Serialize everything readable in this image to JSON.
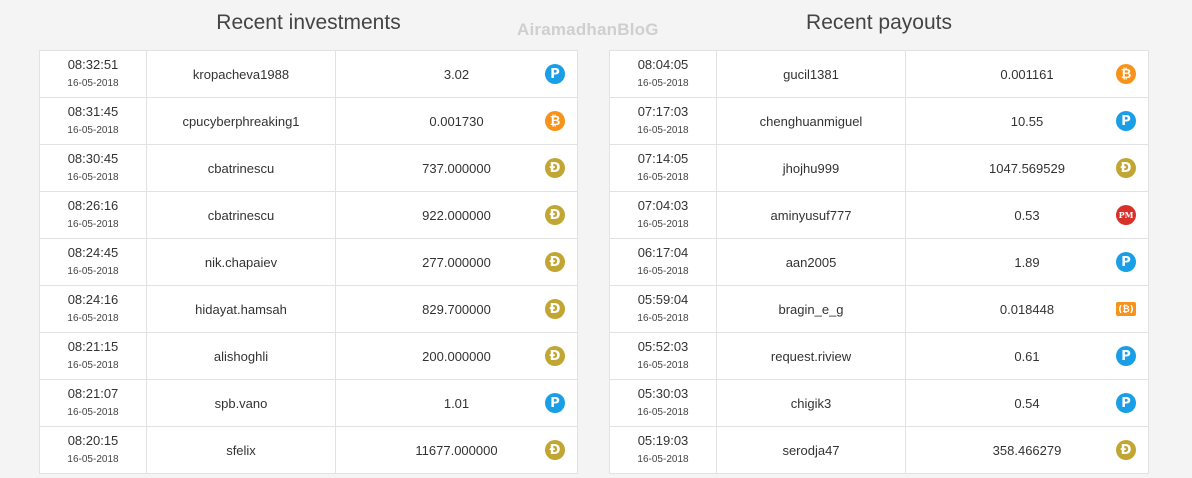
{
  "watermark": "AiramadhanBloG",
  "investments": {
    "title": "Recent investments",
    "rows": [
      {
        "time": "08:32:51",
        "date": "16-05-2018",
        "user": "kropacheva1988",
        "amount": "3.02",
        "coin": "payeer-icon",
        "glyph": "P"
      },
      {
        "time": "08:31:45",
        "date": "16-05-2018",
        "user": "cpucyberphreaking1",
        "amount": "0.001730",
        "coin": "bitcoin-icon",
        "glyph": "₿"
      },
      {
        "time": "08:30:45",
        "date": "16-05-2018",
        "user": "cbatrinescu",
        "amount": "737.000000",
        "coin": "dogecoin-icon",
        "glyph": "Đ"
      },
      {
        "time": "08:26:16",
        "date": "16-05-2018",
        "user": "cbatrinescu",
        "amount": "922.000000",
        "coin": "dogecoin-icon",
        "glyph": "Đ"
      },
      {
        "time": "08:24:45",
        "date": "16-05-2018",
        "user": "nik.chapaiev",
        "amount": "277.000000",
        "coin": "dogecoin-icon",
        "glyph": "Đ"
      },
      {
        "time": "08:24:16",
        "date": "16-05-2018",
        "user": "hidayat.hamsah",
        "amount": "829.700000",
        "coin": "dogecoin-icon",
        "glyph": "Đ"
      },
      {
        "time": "08:21:15",
        "date": "16-05-2018",
        "user": "alishoghli",
        "amount": "200.000000",
        "coin": "dogecoin-icon",
        "glyph": "Đ"
      },
      {
        "time": "08:21:07",
        "date": "16-05-2018",
        "user": "spb.vano",
        "amount": "1.01",
        "coin": "payeer-icon",
        "glyph": "P"
      },
      {
        "time": "08:20:15",
        "date": "16-05-2018",
        "user": "sfelix",
        "amount": "11677.000000",
        "coin": "dogecoin-icon",
        "glyph": "Đ"
      }
    ]
  },
  "payouts": {
    "title": "Recent payouts",
    "rows": [
      {
        "time": "08:04:05",
        "date": "16-05-2018",
        "user": "gucil1381",
        "amount": "0.001161",
        "coin": "bitcoin-icon",
        "glyph": "₿"
      },
      {
        "time": "07:17:03",
        "date": "16-05-2018",
        "user": "chenghuanmiguel",
        "amount": "10.55",
        "coin": "payeer-icon",
        "glyph": "P"
      },
      {
        "time": "07:14:05",
        "date": "16-05-2018",
        "user": "jhojhu999",
        "amount": "1047.569529",
        "coin": "dogecoin-icon",
        "glyph": "Đ"
      },
      {
        "time": "07:04:03",
        "date": "16-05-2018",
        "user": "aminyusuf777",
        "amount": "0.53",
        "coin": "perfect-money-icon",
        "glyph": "PM"
      },
      {
        "time": "06:17:04",
        "date": "16-05-2018",
        "user": "aan2005",
        "amount": "1.89",
        "coin": "payeer-icon",
        "glyph": "P"
      },
      {
        "time": "05:59:04",
        "date": "16-05-2018",
        "user": "bragin_e_g",
        "amount": "0.018448",
        "coin": "bitcoin-cash-icon",
        "glyph": "(₿)"
      },
      {
        "time": "05:52:03",
        "date": "16-05-2018",
        "user": "request.riview",
        "amount": "0.61",
        "coin": "payeer-icon",
        "glyph": "P"
      },
      {
        "time": "05:30:03",
        "date": "16-05-2018",
        "user": "chigik3",
        "amount": "0.54",
        "coin": "payeer-icon",
        "glyph": "P"
      },
      {
        "time": "05:19:03",
        "date": "16-05-2018",
        "user": "serodja47",
        "amount": "358.466279",
        "coin": "dogecoin-icon",
        "glyph": "Đ"
      }
    ]
  }
}
